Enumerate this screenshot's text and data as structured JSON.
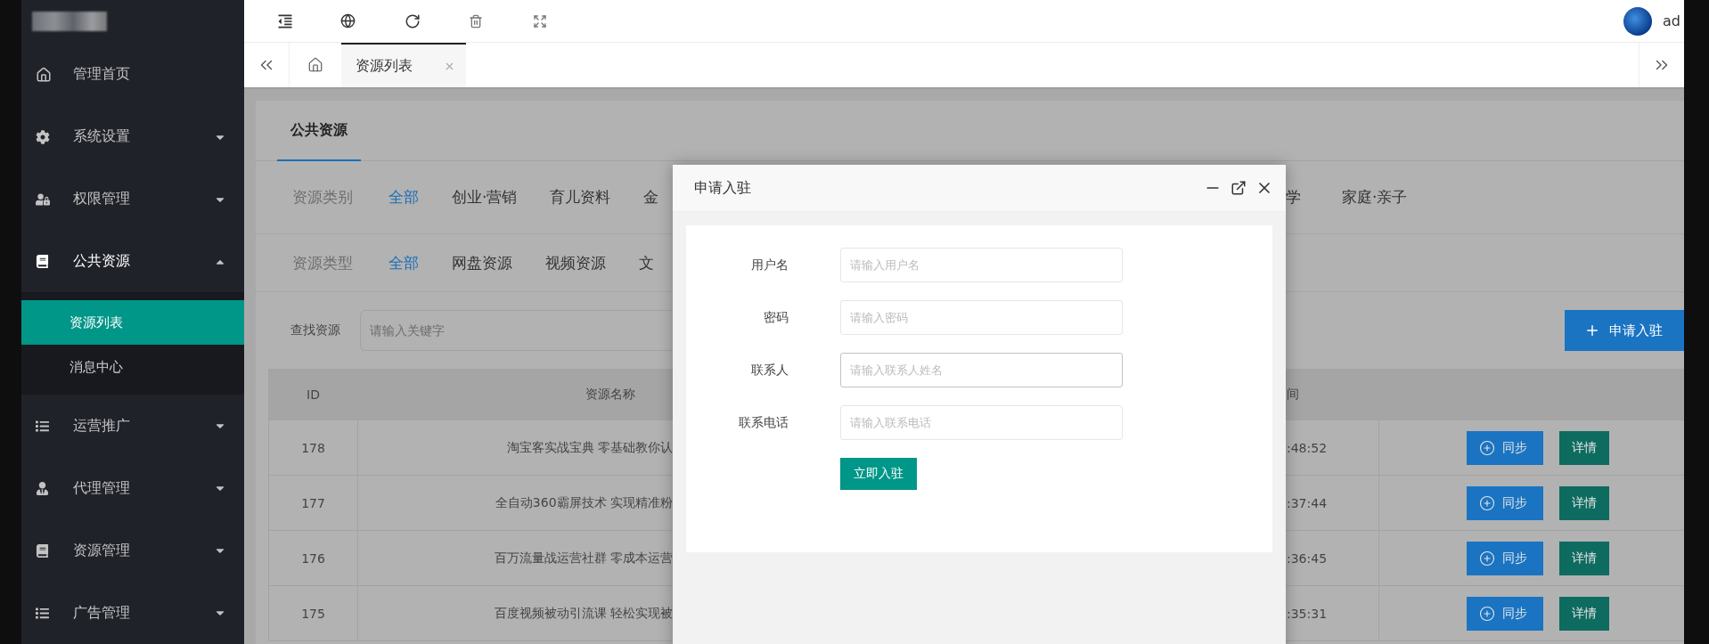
{
  "sidebar": {
    "items": [
      {
        "label": "管理首页",
        "kind": "link",
        "expanded": false
      },
      {
        "label": "系统设置",
        "kind": "menu",
        "expanded": false
      },
      {
        "label": "权限管理",
        "kind": "menu",
        "expanded": false
      },
      {
        "label": "公共资源",
        "kind": "menu",
        "expanded": true,
        "children": [
          {
            "label": "资源列表",
            "selected": true
          },
          {
            "label": "消息中心",
            "selected": false
          }
        ]
      },
      {
        "label": "运营推广",
        "kind": "menu",
        "expanded": false
      },
      {
        "label": "代理管理",
        "kind": "menu",
        "expanded": false
      },
      {
        "label": "资源管理",
        "kind": "menu",
        "expanded": false
      },
      {
        "label": "广告管理",
        "kind": "menu",
        "expanded": false
      }
    ]
  },
  "header": {
    "user": "ad"
  },
  "tabs": [
    {
      "label": "资源列表",
      "selected": true
    }
  ],
  "card": {
    "title": "公共资源",
    "filters": [
      {
        "label": "资源类别",
        "left_options": [
          {
            "label": "全部",
            "selected": true
          },
          {
            "label": "创业·营销",
            "selected": false
          },
          {
            "label": "育儿资料",
            "selected": false
          },
          {
            "label": "金",
            "selected": false
          }
        ],
        "right_options": [
          {
            "label": "学",
            "selected": false
          },
          {
            "label": "家庭·亲子",
            "selected": false
          }
        ]
      },
      {
        "label": "资源类型",
        "left_options": [
          {
            "label": "全部",
            "selected": true
          },
          {
            "label": "网盘资源",
            "selected": false
          },
          {
            "label": "视频资源",
            "selected": false
          },
          {
            "label": "文",
            "selected": false
          }
        ]
      }
    ],
    "search": {
      "label": "查找资源",
      "placeholder": "请输入关键字"
    },
    "add_button": "申请入驻",
    "table": {
      "columns": [
        "ID",
        "资源名称",
        "间"
      ],
      "rows": [
        {
          "id": "178",
          "name": "淘宝客实战宝典 零基础教你认",
          "time": ":48:52",
          "actions": [
            {
              "kind": "sync",
              "label": "同步"
            },
            {
              "kind": "detail",
              "label": "详情"
            }
          ]
        },
        {
          "id": "177",
          "name": "全自动360霸屏技术 实现精准粉",
          "time": ":37:44",
          "actions": [
            {
              "kind": "sync",
              "label": "同步"
            },
            {
              "kind": "detail",
              "label": "详情"
            }
          ]
        },
        {
          "id": "176",
          "name": "百万流量战运营社群 零成本运营",
          "time": ":36:45",
          "actions": [
            {
              "kind": "sync",
              "label": "同步"
            },
            {
              "kind": "detail",
              "label": "详情"
            }
          ]
        },
        {
          "id": "175",
          "name": "百度视频被动引流课 轻松实现被",
          "time": ":35:31",
          "actions": [
            {
              "kind": "sync",
              "label": "同步"
            },
            {
              "kind": "detail",
              "label": "详情"
            }
          ]
        }
      ]
    }
  },
  "dialog": {
    "title": "申请入驻",
    "fields": [
      {
        "label": "用户名",
        "placeholder": "请输入用户名",
        "focused": false
      },
      {
        "label": "密码",
        "placeholder": "请输入密码",
        "focused": false
      },
      {
        "label": "联系人",
        "placeholder": "请输入联系人姓名",
        "focused": true
      },
      {
        "label": "联系电话",
        "placeholder": "请输入联系电话",
        "focused": false
      }
    ],
    "submit": "立即入驻"
  }
}
